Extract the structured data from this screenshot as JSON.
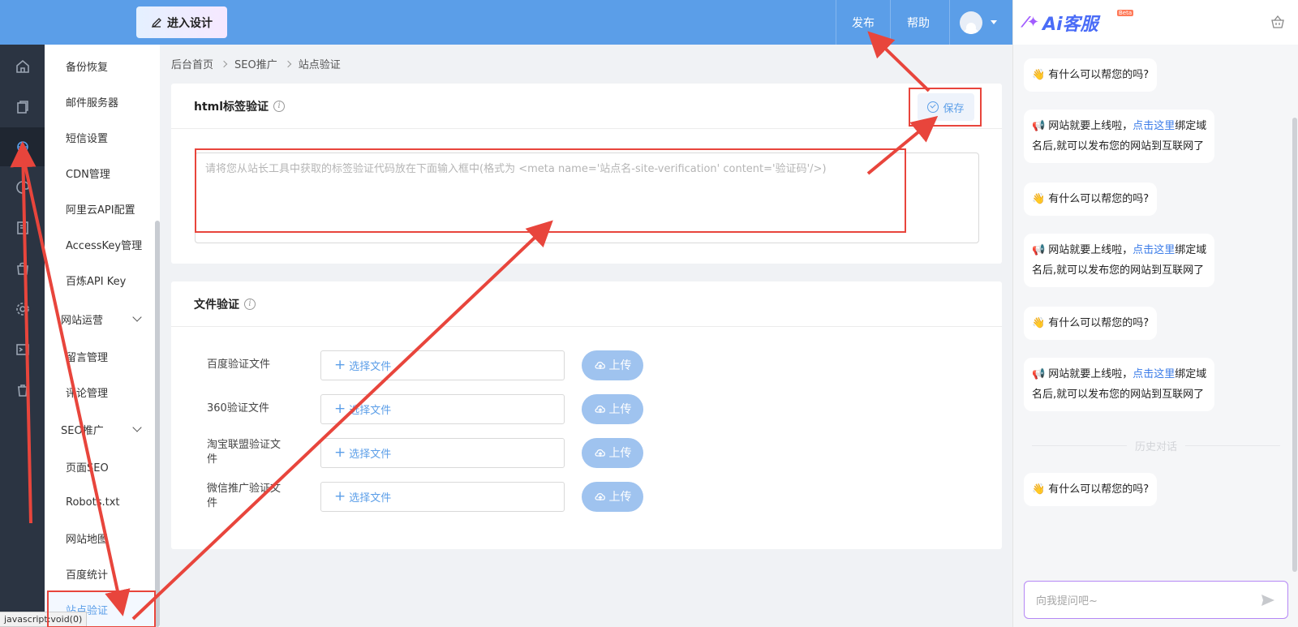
{
  "topbar": {
    "design_button": "进入设计",
    "publish": "发布",
    "help": "帮助"
  },
  "rail": {
    "icons": [
      "home-icon",
      "pages-icon",
      "plugin-icon",
      "palette-icon",
      "book-icon",
      "bag-icon",
      "gear-icon",
      "terminal-icon",
      "trash-icon"
    ],
    "active_index": 2
  },
  "sidebar": {
    "items": [
      {
        "label": "备份恢复"
      },
      {
        "label": "邮件服务器"
      },
      {
        "label": "短信设置"
      },
      {
        "label": "CDN管理"
      },
      {
        "label": "阿里云API配置"
      },
      {
        "label": "AccessKey管理"
      },
      {
        "label": "百炼API Key"
      }
    ],
    "group_ops": "网站运营",
    "ops_items": [
      {
        "label": "留言管理"
      },
      {
        "label": "评论管理"
      }
    ],
    "group_seo": "SEO推广",
    "seo_items": [
      {
        "label": "页面SEO"
      },
      {
        "label": "Robots.txt"
      },
      {
        "label": "网站地图"
      },
      {
        "label": "百度统计"
      },
      {
        "label": "站点验证"
      }
    ]
  },
  "statusbar": "javascript:void(0)",
  "breadcrumb": [
    "后台首页",
    "SEO推广",
    "站点验证"
  ],
  "html_card": {
    "title": "html标签验证",
    "save": "保存",
    "placeholder": "请将您从站长工具中获取的标签验证代码放在下面输入框中(格式为 <meta name='站点名-site-verification' content='验证码'/>)"
  },
  "file_card": {
    "title": "文件验证",
    "choose": "选择文件",
    "upload": "上传",
    "rows": [
      {
        "label": "百度验证文件"
      },
      {
        "label": "360验证文件"
      },
      {
        "label": "淘宝联盟验证文件"
      },
      {
        "label": "微信推广验证文件"
      }
    ]
  },
  "ai": {
    "logo": "Ai客服",
    "beta": "Beta",
    "greeting": "有什么可以帮您的吗?",
    "notice_pre": "网站就要上线啦，",
    "notice_link": "点击这里",
    "notice_post": "绑定域",
    "notice_line2": "名后,就可以发布您的网站到互联网了",
    "history": "历史对话",
    "input_placeholder": "向我提问吧~"
  },
  "colors": {
    "accent": "#5b9ee8",
    "rail": "#2b3442",
    "annotation": "#e8453c"
  }
}
